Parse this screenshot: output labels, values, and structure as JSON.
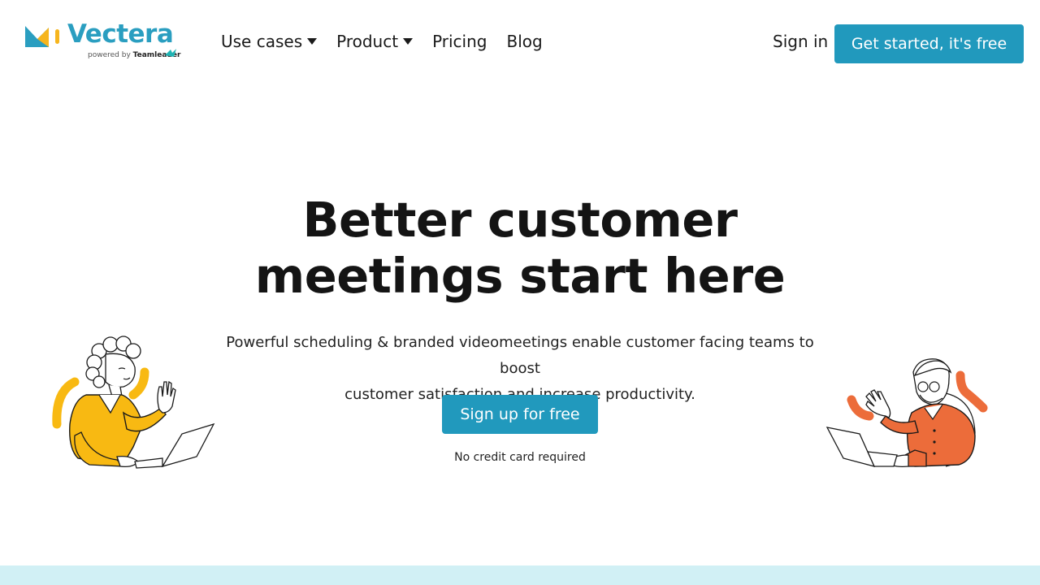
{
  "brand": {
    "name": "Vectera",
    "powered_prefix": "powered by",
    "powered_company": "Teamleader",
    "accent": "#2199bd",
    "logo_yellow": "#f6b51d",
    "logo_blue": "#2a9ec0"
  },
  "nav": {
    "items": [
      {
        "label": "Use cases",
        "dropdown": true
      },
      {
        "label": "Product",
        "dropdown": true
      },
      {
        "label": "Pricing",
        "dropdown": false
      },
      {
        "label": "Blog",
        "dropdown": false
      }
    ],
    "signin_label": "Sign in",
    "cta_label": "Get started, it's free"
  },
  "hero": {
    "title_line1": "Better customer",
    "title_line2": "meetings start here",
    "subtitle_line1": "Powerful scheduling & branded videomeetings enable customer facing teams to boost",
    "subtitle_line2": "customer satisfaction and increase productivity.",
    "cta_label": "Sign up for free",
    "note": "No credit card required"
  },
  "illustrations": {
    "left": {
      "icon": "woman-waving-laptop-illustration",
      "color": "#f8b912"
    },
    "right": {
      "icon": "man-waving-laptop-illustration",
      "color": "#ec6c3a"
    }
  },
  "footer_band_color": "#d1f0f5"
}
